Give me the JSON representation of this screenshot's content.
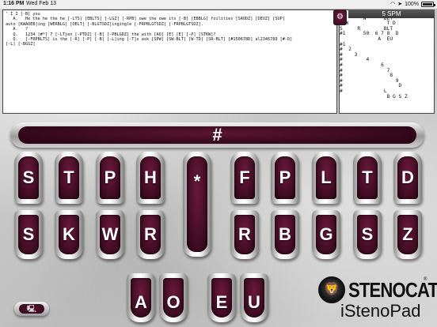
{
  "status_bar": {
    "time": "1:16 PM",
    "date": "Wed Feb 13",
    "battery": "100%"
  },
  "transcript": {
    "lines": [
      "' I I [-B] you",
      "   A.   He the he the he [-LTS] [EBLTS] [-LGZ] [-RPB] owe the owe its [-B] [EBBLG] foilities [SAODZ] [DEUZ] [SUP]",
      "auto [KWAOEB]ing [WERBLG] [OELT] [-BLGTSDZ]ingingle [-FRPBLGTSDZ] [-FRPBLGTSDZ].",
      "   A.   ?",
      "   Q.   1234 [#*] 7 [-LTjen [-PTDZ] [-B] [-PBLGDZ] the with [AO] [E] [E] [-P] [STKW]?",
      "   Q.   [-FRPBLTS] is the [-R] [-P] [-B] [-L]ing [-T]s ask [SPW] [SW-BLT] [W-TD] [SR-BLT] [#150678D] al2346789 [#-D]",
      "[-L] [-BGSZ]"
    ]
  },
  "settings": {
    "gear_glyph": "⚙"
  },
  "tape": {
    "badge": "5 SPM",
    "lines": [
      "S    PH",
      "O       W      BLT",
      "  W             T D",
      "S     R        BLT",
      "#1      50  6 7 8  D",
      "             A  EU",
      "#1",
      "#  2",
      "#    3",
      "#        4",
      "#             6",
      "#               7",
      "#                8",
      "#                  9",
      "#                   D",
      "#              L",
      "                B G S Z"
    ]
  },
  "number_bar": {
    "label": "#"
  },
  "keys": {
    "top_row": [
      "S",
      "T",
      "P",
      "H",
      "*",
      "F",
      "P",
      "L",
      "T",
      "D"
    ],
    "bottom_row": [
      "S",
      "K",
      "W",
      "R",
      "R",
      "B",
      "G",
      "S",
      "Z"
    ],
    "vowels": [
      "A",
      "O",
      "E",
      "U"
    ]
  },
  "utility": {
    "glyph": "🖳"
  },
  "branding": {
    "name": "STENOCAT",
    "registered": "®",
    "product": "iStenoPad"
  },
  "colors": {
    "key_face": "#4a0f28",
    "key_ring": "#e8e8e8",
    "background": "#cfcfcf"
  }
}
